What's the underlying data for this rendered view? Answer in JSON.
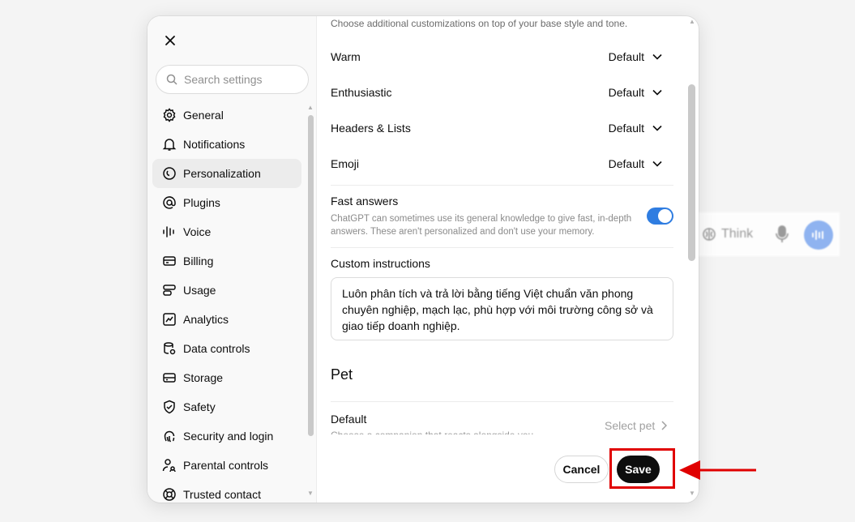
{
  "background": {
    "think_label": "Think"
  },
  "sidebar": {
    "search_placeholder": "Search settings",
    "items": [
      {
        "label": "General",
        "icon": "gear-icon"
      },
      {
        "label": "Notifications",
        "icon": "bell-icon"
      },
      {
        "label": "Personalization",
        "icon": "personalization-icon",
        "active": true
      },
      {
        "label": "Plugins",
        "icon": "at-sign-icon"
      },
      {
        "label": "Voice",
        "icon": "voice-wave-icon"
      },
      {
        "label": "Billing",
        "icon": "credit-card-icon"
      },
      {
        "label": "Usage",
        "icon": "usage-icon"
      },
      {
        "label": "Analytics",
        "icon": "chart-icon"
      },
      {
        "label": "Data controls",
        "icon": "database-gear-icon"
      },
      {
        "label": "Storage",
        "icon": "storage-icon"
      },
      {
        "label": "Safety",
        "icon": "shield-check-icon"
      },
      {
        "label": "Security and login",
        "icon": "fingerprint-icon"
      },
      {
        "label": "Parental controls",
        "icon": "parent-user-icon"
      },
      {
        "label": "Trusted contact",
        "icon": "lifebuoy-icon"
      }
    ]
  },
  "content": {
    "intro": "Choose additional customizations on top of your base style and tone.",
    "traits": [
      {
        "label": "Warm",
        "value": "Default"
      },
      {
        "label": "Enthusiastic",
        "value": "Default"
      },
      {
        "label": "Headers & Lists",
        "value": "Default"
      },
      {
        "label": "Emoji",
        "value": "Default"
      }
    ],
    "fast_answers": {
      "title": "Fast answers",
      "description": "ChatGPT can sometimes use its general knowledge to give fast, in-depth answers. These aren't personalized and don't use your memory.",
      "enabled": true
    },
    "custom_instructions": {
      "title": "Custom instructions",
      "value": "Luôn phân tích và trả lời bằng tiếng Việt chuẩn văn phong chuyên nghiệp, mạch lạc, phù hợp với môi trường công sở và giao tiếp doanh nghiệp."
    },
    "pet": {
      "section_title": "Pet",
      "row_title": "Default",
      "row_subtitle": "Choose a companion that reacts alongside you",
      "select_label": "Select pet"
    }
  },
  "footer": {
    "cancel_label": "Cancel",
    "save_label": "Save"
  },
  "colors": {
    "accent": "#2f7de1",
    "highlight": "#e00000"
  }
}
